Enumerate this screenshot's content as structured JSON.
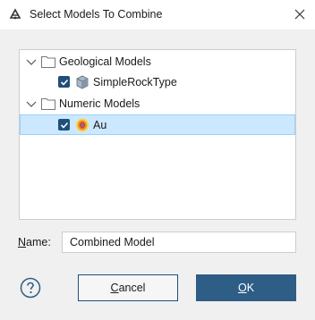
{
  "window": {
    "title": "Select Models To Combine",
    "close_label": "Close"
  },
  "tree": {
    "groups": [
      {
        "label": "Geological Models",
        "expanded": true,
        "items": [
          {
            "label": "SimpleRockType",
            "checked": true,
            "icon": "geological-model-icon"
          }
        ]
      },
      {
        "label": "Numeric Models",
        "expanded": true,
        "items": [
          {
            "label": "Au",
            "checked": true,
            "selected": true,
            "icon": "numeric-model-icon"
          }
        ]
      }
    ]
  },
  "form": {
    "name_label_prefix": "N",
    "name_label_rest": "ame:",
    "name_value": "Combined Model"
  },
  "buttons": {
    "cancel_prefix": "C",
    "cancel_rest": "ancel",
    "ok_prefix": "O",
    "ok_rest": "K"
  },
  "colors": {
    "accent": "#2e5d86",
    "checkbox": "#1f4f7a",
    "selection_bg": "#cce8ff",
    "selection_border": "#99d1ff"
  }
}
